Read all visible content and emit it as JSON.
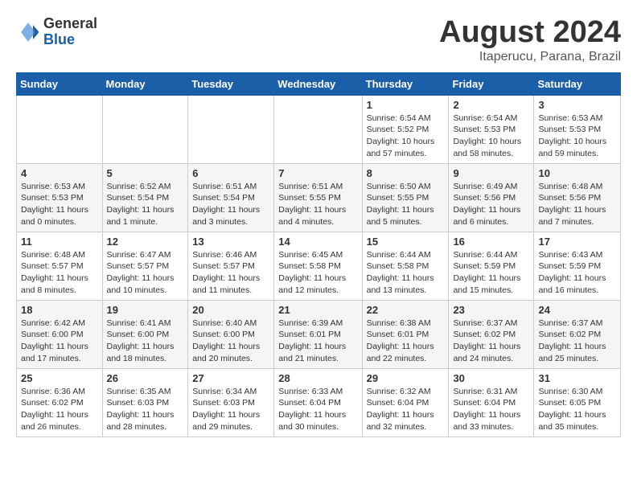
{
  "header": {
    "logo_general": "General",
    "logo_blue": "Blue",
    "month_title": "August 2024",
    "location": "Itaperucu, Parana, Brazil"
  },
  "days_of_week": [
    "Sunday",
    "Monday",
    "Tuesday",
    "Wednesday",
    "Thursday",
    "Friday",
    "Saturday"
  ],
  "weeks": [
    [
      {
        "day": "",
        "info": ""
      },
      {
        "day": "",
        "info": ""
      },
      {
        "day": "",
        "info": ""
      },
      {
        "day": "",
        "info": ""
      },
      {
        "day": "1",
        "info": "Sunrise: 6:54 AM\nSunset: 5:52 PM\nDaylight: 10 hours and 57 minutes."
      },
      {
        "day": "2",
        "info": "Sunrise: 6:54 AM\nSunset: 5:53 PM\nDaylight: 10 hours and 58 minutes."
      },
      {
        "day": "3",
        "info": "Sunrise: 6:53 AM\nSunset: 5:53 PM\nDaylight: 10 hours and 59 minutes."
      }
    ],
    [
      {
        "day": "4",
        "info": "Sunrise: 6:53 AM\nSunset: 5:53 PM\nDaylight: 11 hours and 0 minutes."
      },
      {
        "day": "5",
        "info": "Sunrise: 6:52 AM\nSunset: 5:54 PM\nDaylight: 11 hours and 1 minute."
      },
      {
        "day": "6",
        "info": "Sunrise: 6:51 AM\nSunset: 5:54 PM\nDaylight: 11 hours and 3 minutes."
      },
      {
        "day": "7",
        "info": "Sunrise: 6:51 AM\nSunset: 5:55 PM\nDaylight: 11 hours and 4 minutes."
      },
      {
        "day": "8",
        "info": "Sunrise: 6:50 AM\nSunset: 5:55 PM\nDaylight: 11 hours and 5 minutes."
      },
      {
        "day": "9",
        "info": "Sunrise: 6:49 AM\nSunset: 5:56 PM\nDaylight: 11 hours and 6 minutes."
      },
      {
        "day": "10",
        "info": "Sunrise: 6:48 AM\nSunset: 5:56 PM\nDaylight: 11 hours and 7 minutes."
      }
    ],
    [
      {
        "day": "11",
        "info": "Sunrise: 6:48 AM\nSunset: 5:57 PM\nDaylight: 11 hours and 8 minutes."
      },
      {
        "day": "12",
        "info": "Sunrise: 6:47 AM\nSunset: 5:57 PM\nDaylight: 11 hours and 10 minutes."
      },
      {
        "day": "13",
        "info": "Sunrise: 6:46 AM\nSunset: 5:57 PM\nDaylight: 11 hours and 11 minutes."
      },
      {
        "day": "14",
        "info": "Sunrise: 6:45 AM\nSunset: 5:58 PM\nDaylight: 11 hours and 12 minutes."
      },
      {
        "day": "15",
        "info": "Sunrise: 6:44 AM\nSunset: 5:58 PM\nDaylight: 11 hours and 13 minutes."
      },
      {
        "day": "16",
        "info": "Sunrise: 6:44 AM\nSunset: 5:59 PM\nDaylight: 11 hours and 15 minutes."
      },
      {
        "day": "17",
        "info": "Sunrise: 6:43 AM\nSunset: 5:59 PM\nDaylight: 11 hours and 16 minutes."
      }
    ],
    [
      {
        "day": "18",
        "info": "Sunrise: 6:42 AM\nSunset: 6:00 PM\nDaylight: 11 hours and 17 minutes."
      },
      {
        "day": "19",
        "info": "Sunrise: 6:41 AM\nSunset: 6:00 PM\nDaylight: 11 hours and 18 minutes."
      },
      {
        "day": "20",
        "info": "Sunrise: 6:40 AM\nSunset: 6:00 PM\nDaylight: 11 hours and 20 minutes."
      },
      {
        "day": "21",
        "info": "Sunrise: 6:39 AM\nSunset: 6:01 PM\nDaylight: 11 hours and 21 minutes."
      },
      {
        "day": "22",
        "info": "Sunrise: 6:38 AM\nSunset: 6:01 PM\nDaylight: 11 hours and 22 minutes."
      },
      {
        "day": "23",
        "info": "Sunrise: 6:37 AM\nSunset: 6:02 PM\nDaylight: 11 hours and 24 minutes."
      },
      {
        "day": "24",
        "info": "Sunrise: 6:37 AM\nSunset: 6:02 PM\nDaylight: 11 hours and 25 minutes."
      }
    ],
    [
      {
        "day": "25",
        "info": "Sunrise: 6:36 AM\nSunset: 6:02 PM\nDaylight: 11 hours and 26 minutes."
      },
      {
        "day": "26",
        "info": "Sunrise: 6:35 AM\nSunset: 6:03 PM\nDaylight: 11 hours and 28 minutes."
      },
      {
        "day": "27",
        "info": "Sunrise: 6:34 AM\nSunset: 6:03 PM\nDaylight: 11 hours and 29 minutes."
      },
      {
        "day": "28",
        "info": "Sunrise: 6:33 AM\nSunset: 6:04 PM\nDaylight: 11 hours and 30 minutes."
      },
      {
        "day": "29",
        "info": "Sunrise: 6:32 AM\nSunset: 6:04 PM\nDaylight: 11 hours and 32 minutes."
      },
      {
        "day": "30",
        "info": "Sunrise: 6:31 AM\nSunset: 6:04 PM\nDaylight: 11 hours and 33 minutes."
      },
      {
        "day": "31",
        "info": "Sunrise: 6:30 AM\nSunset: 6:05 PM\nDaylight: 11 hours and 35 minutes."
      }
    ]
  ]
}
